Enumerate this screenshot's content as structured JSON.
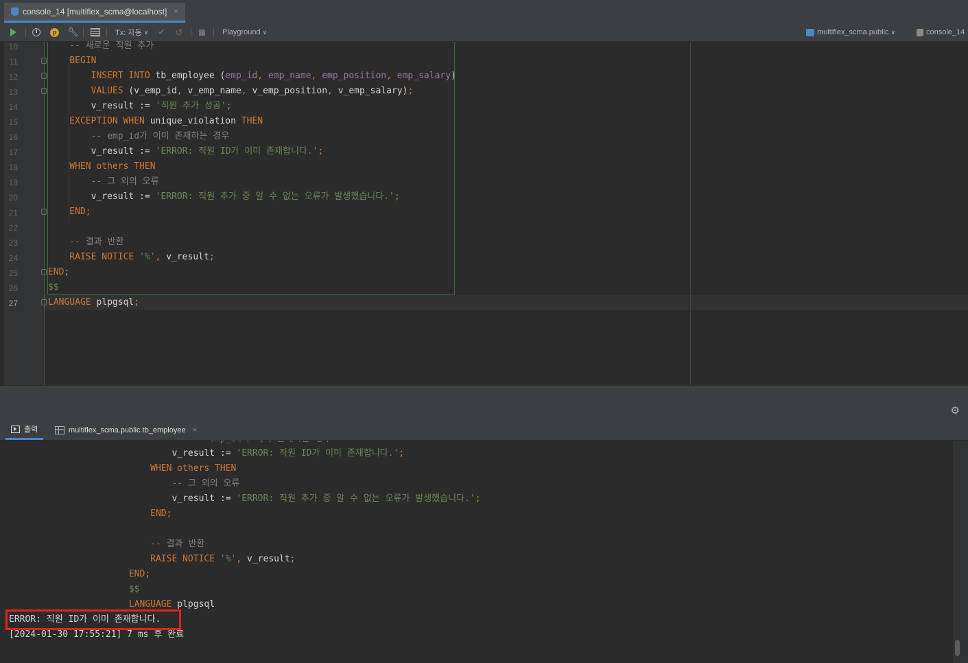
{
  "tab": {
    "title": "console_14 [multiflex_scma@localhost]",
    "close": "×"
  },
  "toolbar": {
    "p_badge": "p",
    "tx_label": "Tx: 자동",
    "playground": "Playground",
    "schema": "multiflex_scma.public",
    "console": "console_14"
  },
  "editor": {
    "line_numbers": [
      "10",
      "11",
      "12",
      "13",
      "14",
      "15",
      "16",
      "17",
      "18",
      "19",
      "20",
      "21",
      "22",
      "23",
      "24",
      "25",
      "26",
      "27"
    ],
    "current_line": "27"
  },
  "output_tabs": [
    {
      "label": "출력"
    },
    {
      "label": "multiflex_scma.public.tb_employee",
      "close": "×"
    }
  ],
  "output": {
    "error_message": "ERROR: 직원 ID가 이미 존재합니다.",
    "status_line": "[2024-01-30 17:55:21] 7 ms 후 완료"
  }
}
